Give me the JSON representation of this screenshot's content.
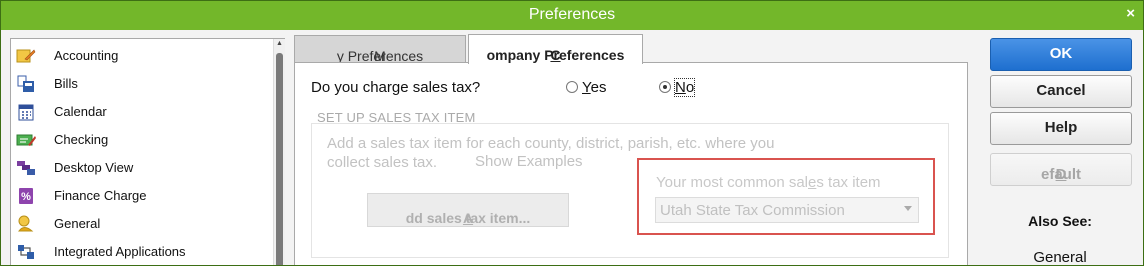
{
  "window": {
    "title": "Preferences",
    "close_glyph": "×"
  },
  "sidebar": {
    "items": [
      {
        "label": "Accounting",
        "icon": "accounting-icon"
      },
      {
        "label": "Bills",
        "icon": "bills-icon"
      },
      {
        "label": "Calendar",
        "icon": "calendar-icon"
      },
      {
        "label": "Checking",
        "icon": "checking-icon"
      },
      {
        "label": "Desktop View",
        "icon": "desktop-view-icon"
      },
      {
        "label": "Finance Charge",
        "icon": "finance-charge-icon"
      },
      {
        "label": "General",
        "icon": "general-icon"
      },
      {
        "label": "Integrated Applications",
        "icon": "integrated-applications-icon"
      }
    ]
  },
  "tabs": {
    "my_prefix": "M",
    "my_rest": "y Preferences",
    "company_prefix": "C",
    "company_rest": "ompany Preferences",
    "active": "company"
  },
  "sales_tax": {
    "question": "Do you charge sales tax?",
    "yes_prefix": "Y",
    "yes_rest": "es",
    "no_prefix": "N",
    "no_rest": "o",
    "selected": "No",
    "section_header": "SET UP SALES TAX ITEM",
    "description": "Add a sales tax item for each county, district, parish, etc. where you collect sales tax.",
    "show_examples": "Show Examples",
    "add_button_prefix": "A",
    "add_button_rest": "dd sales tax item...",
    "common_label_a": "Your most common sal",
    "common_label_u": "e",
    "common_label_b": "s tax item",
    "common_value": "Utah State Tax Commission"
  },
  "buttons": {
    "ok": "OK",
    "cancel": "Cancel",
    "help": "Help",
    "default_prefix": "D",
    "default_rest": "efault"
  },
  "also_see": {
    "label": "Also See:",
    "link": "General"
  },
  "colors": {
    "titlebar": "#73b72a",
    "ok_button": "#2a7ad9",
    "highlight": "#d9534f"
  }
}
